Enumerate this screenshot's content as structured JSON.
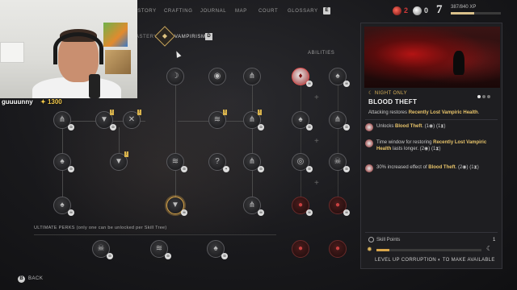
{
  "nav": {
    "items": [
      {
        "label": "ISTORY"
      },
      {
        "label": "CRAFTING"
      },
      {
        "label": "JOURNAL"
      },
      {
        "label": "MAP"
      },
      {
        "label": "COURT"
      },
      {
        "label": "GLOSSARY"
      }
    ],
    "key_hint": "E"
  },
  "resources": {
    "blood": "2",
    "coins": "0",
    "level": "7",
    "xp_text": "387/840 XP",
    "xp_fraction": 0.46
  },
  "tabs": {
    "mastery": "ASTERY",
    "vampirism": "VAMPIRISM",
    "vampirism_key": "D"
  },
  "tree": {
    "abilities_label": "ABILITIES",
    "ultimate_label": "ULTIMATE PERKS (only one can be unlocked per Skill Tree)"
  },
  "stream": {
    "username": "guuuunny",
    "points": "1300"
  },
  "detail": {
    "night_only": "NIGHT ONLY",
    "name": "BLOOD THEFT",
    "desc_prefix": "Attacking restores ",
    "desc_highlight": "Recently Lost Vampiric Health",
    "desc_suffix": ".",
    "upgrades": [
      {
        "prefix": "Unlocks ",
        "highlight": "Blood Theft",
        "suffix": ".",
        "cost": "(1",
        "cost_mid": ") (1",
        "cost_end": ")"
      },
      {
        "prefix": "Time window for restoring ",
        "highlight": "Recently Lost Vampiric Health",
        "suffix": " lasts longer.",
        "cost": "(2",
        "cost_mid": ") (1",
        "cost_end": ")"
      },
      {
        "prefix": "30% increased effect of ",
        "highlight": "Blood Theft",
        "suffix": ".",
        "cost": "(2",
        "cost_mid": ") (1",
        "cost_end": ")"
      }
    ],
    "skill_points_label": "Skill Points",
    "skill_points_value": "1",
    "corruption_text": "LEVEL UP CORRUPTION",
    "corruption_suffix": "TO MAKE AVAILABLE",
    "corruption_fraction": 0.12
  },
  "footer": {
    "back_key": "B",
    "back_label": "BACK"
  }
}
